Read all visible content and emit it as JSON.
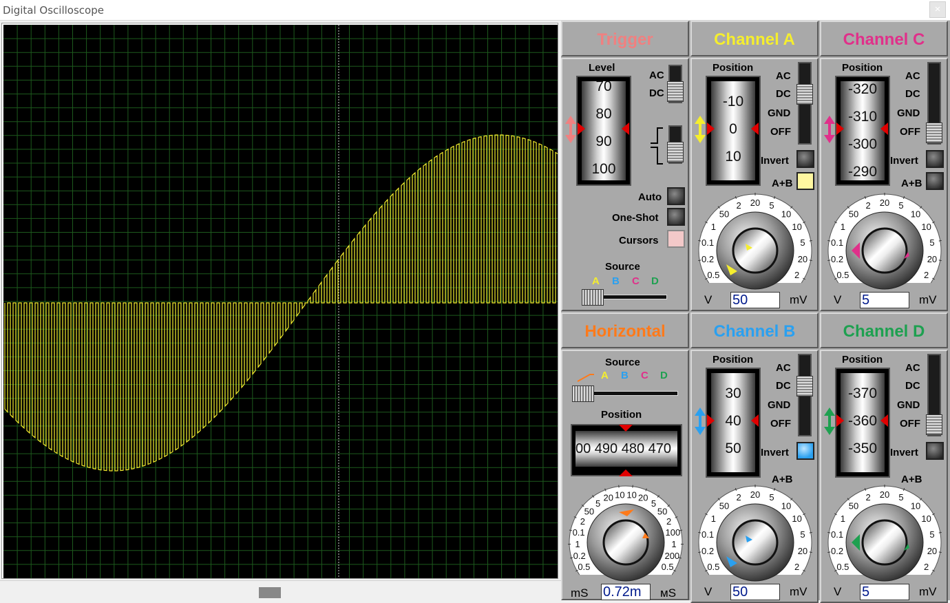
{
  "window": {
    "title": "Digital Oscilloscope",
    "close_glyph": "×"
  },
  "colors": {
    "a": "#f5ee2e",
    "b": "#2aa0f0",
    "c": "#e0308a",
    "d": "#1ea050",
    "trigger": "#f08080",
    "horizontal": "#ff7a1a"
  },
  "trigger": {
    "header": "Trigger",
    "level_label": "Level",
    "level_scale": [
      "70",
      "80",
      "90",
      "100"
    ],
    "coupling": [
      "AC",
      "DC"
    ],
    "auto": "Auto",
    "one_shot": "One-Shot",
    "cursors": "Cursors",
    "source_label": "Source",
    "source_letters": [
      "A",
      "B",
      "C",
      "D"
    ]
  },
  "horizontal": {
    "header": "Horizontal",
    "source_label": "Source",
    "source_letters": [
      "A",
      "B",
      "C",
      "D"
    ],
    "position_label": "Position",
    "position_scale": "00 490 480 470",
    "dial_labels": [
      "0.5",
      "0.2",
      "1",
      "0.1",
      "2",
      "50",
      "5",
      "20",
      "10",
      "10",
      "20",
      "5",
      "50",
      "2",
      "100",
      "1",
      "200",
      "0.5"
    ],
    "unit_left": "mS",
    "unit_right": "мS",
    "value": "0.72m"
  },
  "channels": [
    {
      "id": "a",
      "header": "Channel A",
      "position_label": "Position",
      "scale": [
        "-10",
        "0",
        "10"
      ],
      "coupling": [
        "AC",
        "DC",
        "GND",
        "OFF"
      ],
      "invert": "Invert",
      "a_plus_b": "A+B",
      "unit_left": "V",
      "unit_right": "mV",
      "value": "50"
    },
    {
      "id": "c",
      "header": "Channel C",
      "position_label": "Position",
      "scale": [
        "-320",
        "-310",
        "-300",
        "-290"
      ],
      "coupling": [
        "AC",
        "DC",
        "GND",
        "OFF"
      ],
      "invert": "Invert",
      "a_plus_b": "A+B",
      "unit_left": "V",
      "unit_right": "mV",
      "value": "5"
    },
    {
      "id": "b",
      "header": "Channel B",
      "position_label": "Position",
      "scale": [
        "30",
        "40",
        "50"
      ],
      "coupling": [
        "AC",
        "DC",
        "GND",
        "OFF"
      ],
      "invert": "Invert",
      "a_plus_b": "A+B",
      "unit_left": "V",
      "unit_right": "mV",
      "value": "50"
    },
    {
      "id": "d",
      "header": "Channel D",
      "position_label": "Position",
      "scale": [
        "-370",
        "-360",
        "-350"
      ],
      "coupling": [
        "AC",
        "DC",
        "GND",
        "OFF"
      ],
      "invert": "Invert",
      "a_plus_b": "A+B",
      "unit_left": "V",
      "unit_right": "mV",
      "value": "5"
    }
  ],
  "volt_dial_labels": [
    "0.5",
    "0.2",
    "0.1",
    "1",
    "50",
    "2",
    "20",
    "5",
    "10",
    "10",
    "5",
    "20",
    "2"
  ]
}
